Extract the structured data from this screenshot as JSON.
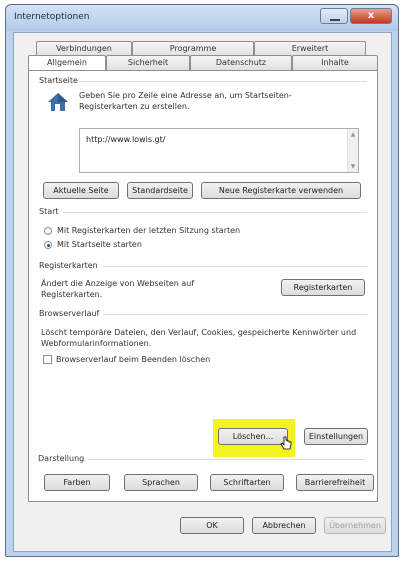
{
  "window": {
    "title": "Internetoptionen",
    "close_label": "x"
  },
  "tabs_back": [
    "Verbindungen",
    "Programme",
    "Erweitert"
  ],
  "tabs_front": [
    "Allgemein",
    "Sicherheit",
    "Datenschutz",
    "Inhalte"
  ],
  "active_tab": "Allgemein",
  "startseite": {
    "group": "Startseite",
    "desc": "Geben Sie pro Zeile eine Adresse an, um Startseiten-Registerkarten zu erstellen.",
    "url": "http://www.lowis.gt/",
    "buttons": [
      "Aktuelle Seite",
      "Standardseite",
      "Neue Registerkarte verwenden"
    ]
  },
  "start": {
    "group": "Start",
    "options": [
      "Mit Registerkarten der letzten Sitzung starten",
      "Mit Startseite starten"
    ],
    "selected": 1
  },
  "registerkarten": {
    "group": "Registerkarten",
    "desc": "Ändert die Anzeige von Webseiten auf Registerkarten.",
    "button": "Registerkarten"
  },
  "browserverlauf": {
    "group": "Browserverlauf",
    "desc": "Löscht temporäre Dateien, den Verlauf, Cookies, gespeicherte Kennwörter und Webformularinformationen.",
    "checkbox": "Browserverlauf beim Beenden löschen",
    "checked": false,
    "delete_button": "Löschen...",
    "settings_button": "Einstellungen"
  },
  "darstellung": {
    "group": "Darstellung",
    "buttons": [
      "Farben",
      "Sprachen",
      "Schriftarten",
      "Barrierefreiheit"
    ]
  },
  "footer": {
    "ok": "OK",
    "cancel": "Abbrechen",
    "apply": "Übernehmen"
  },
  "colors": {
    "highlight": "#f4f322",
    "titlebar": "#c6d8ef",
    "close_button": "#c2391e"
  }
}
